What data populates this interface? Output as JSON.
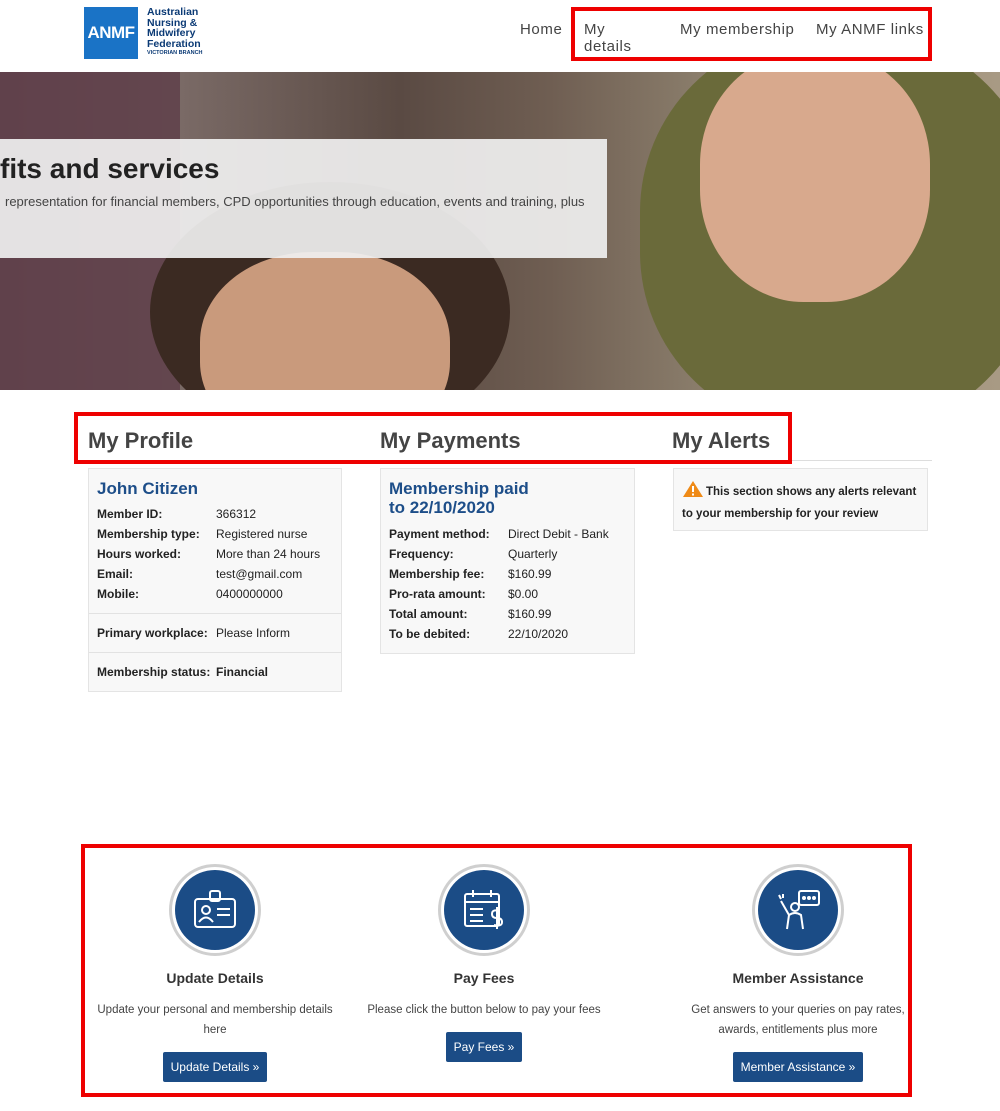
{
  "logo": {
    "mark": "ANMF",
    "line1": "Australian",
    "line2": "Nursing &",
    "line3": "Midwifery",
    "line4": "Federation",
    "branch": "VICTORIAN BRANCH"
  },
  "nav": {
    "home": "Home",
    "my_details": "My details",
    "my_membership": "My membership",
    "my_anmf_links": "My ANMF links"
  },
  "hero": {
    "title": "fits and services",
    "text": "representation for financial members, CPD opportunities through education, events and training, plus"
  },
  "sections": {
    "profile": "My Profile",
    "payments": "My Payments",
    "alerts": "My Alerts"
  },
  "profile": {
    "name": "John Citizen",
    "rows": [
      {
        "label": "Member ID:",
        "value": "366312"
      },
      {
        "label": "Membership type:",
        "value": "Registered nurse"
      },
      {
        "label": "Hours worked:",
        "value": "More than 24 hours"
      },
      {
        "label": "Email:",
        "value": "test@gmail.com"
      },
      {
        "label": "Mobile:",
        "value": "0400000000"
      }
    ],
    "workplace_label": "Primary workplace:",
    "workplace_value": "Please Inform",
    "status_label": "Membership status:",
    "status_value": "Financial",
    "status_color": "#1eaa3b"
  },
  "payments": {
    "title_line1": "Membership paid",
    "title_line2": "to 22/10/2020",
    "rows": [
      {
        "label": "Payment method:",
        "value": "Direct Debit - Bank"
      },
      {
        "label": "Frequency:",
        "value": "Quarterly"
      },
      {
        "label": "Membership fee:",
        "value": "$160.99"
      },
      {
        "label": "Pro-rata amount:",
        "value": "$0.00"
      },
      {
        "label": "Total amount:",
        "value": "$160.99"
      },
      {
        "label": "To be debited:",
        "value": "22/10/2020"
      }
    ]
  },
  "alerts": {
    "icon": "warning-icon",
    "text": "This section shows any alerts relevant to your membership for your review"
  },
  "services": [
    {
      "icon": "id-card-icon",
      "title": "Update Details",
      "description": "Update your personal and membership details here",
      "button": "Update Details »"
    },
    {
      "icon": "calendar-dollar-icon",
      "title": "Pay Fees",
      "description": "Please click the button below to pay your fees",
      "button": "Pay Fees »"
    },
    {
      "icon": "assistance-icon",
      "title": "Member Assistance",
      "description": "Get answers to your queries on pay rates, awards, entitlements plus more",
      "button": "Member Assistance »"
    }
  ],
  "colors": {
    "brand_blue": "#1b4c86",
    "highlight_red": "#ee0000",
    "status_green": "#1eaa3b"
  }
}
